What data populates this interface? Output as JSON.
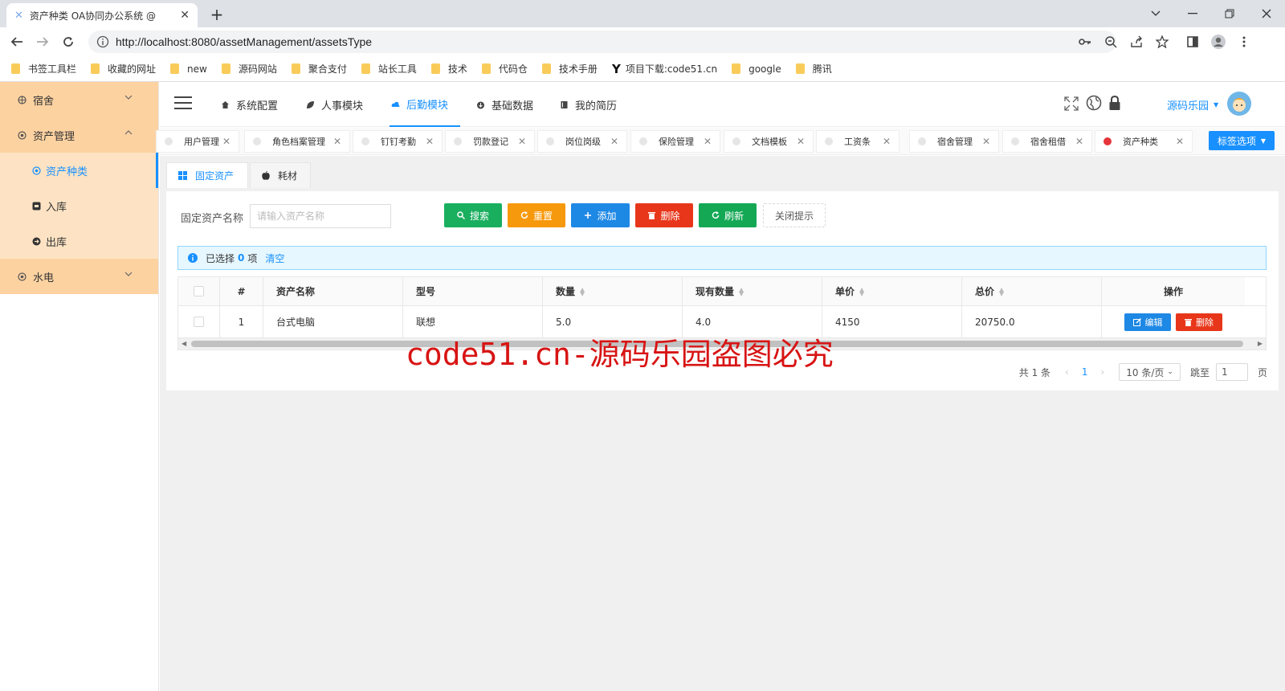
{
  "browser": {
    "tab_title": "资产种类 OA协同办公系统 @",
    "url": "http://localhost:8080/assetManagement/assetsType",
    "bookmarks": [
      "书签工具栏",
      "收藏的网址",
      "new",
      "源码网站",
      "聚合支付",
      "站长工具",
      "技术",
      "代码仓",
      "技术手册",
      "项目下载:code51.cn",
      "google",
      "腾讯"
    ]
  },
  "sidebar": {
    "menus": [
      {
        "label": "宿舍",
        "expanded": false
      },
      {
        "label": "资产管理",
        "expanded": true
      },
      {
        "label": "水电",
        "expanded": false
      }
    ],
    "sub_items": [
      {
        "label": "资产种类",
        "active": true
      },
      {
        "label": "入库",
        "active": false
      },
      {
        "label": "出库",
        "active": false
      }
    ]
  },
  "header": {
    "nav": [
      "系统配置",
      "人事模块",
      "后勤模块",
      "基础数据",
      "我的简历"
    ],
    "active_nav": "后勤模块",
    "user_name": "源码乐园"
  },
  "tags": {
    "items": [
      "用户管理",
      "角色档案管理",
      "钉钉考勤",
      "罚款登记",
      "岗位岗级",
      "保险管理",
      "文档模板",
      "工资条",
      "宿舍管理",
      "宿舍租借",
      "资产种类"
    ],
    "active": "资产种类",
    "options_label": "标签选项"
  },
  "content": {
    "tabs": [
      "固定资产",
      "耗材"
    ],
    "active_tab": "固定资产",
    "search": {
      "label": "固定资产名称",
      "placeholder": "请输入资产名称",
      "value": ""
    },
    "buttons": {
      "search": "搜索",
      "reset": "重置",
      "add": "添加",
      "delete": "删除",
      "refresh": "刷新",
      "close_tip": "关闭提示"
    },
    "notice": {
      "prefix": "已选择",
      "count": "0",
      "suffix": "项",
      "clear": "清空"
    },
    "table": {
      "columns": [
        "#",
        "资产名称",
        "型号",
        "数量",
        "现有数量",
        "单价",
        "总价",
        "操作"
      ],
      "rows": [
        {
          "index": "1",
          "name": "台式电脑",
          "model": "联想",
          "quantity": "5.0",
          "current": "4.0",
          "unit_price": "4150",
          "total": "20750.0",
          "edit": "编辑",
          "delete": "删除"
        }
      ]
    },
    "pager": {
      "total": "共 1 条",
      "current": "1",
      "page_size": "10 条/页",
      "goto_label": "跳至",
      "goto_value": "1",
      "page_suffix": "页"
    }
  },
  "watermark": "code51.cn-源码乐园盗图必究",
  "colors": {
    "accent": "#1890ff",
    "sidebar_menu": "#fdd2a1",
    "sidebar_sub": "#fde3c3",
    "search": "#1aae5f",
    "reset": "#f7990c",
    "add": "#1e88e5",
    "delete": "#e8361a",
    "refresh": "#14a855"
  }
}
